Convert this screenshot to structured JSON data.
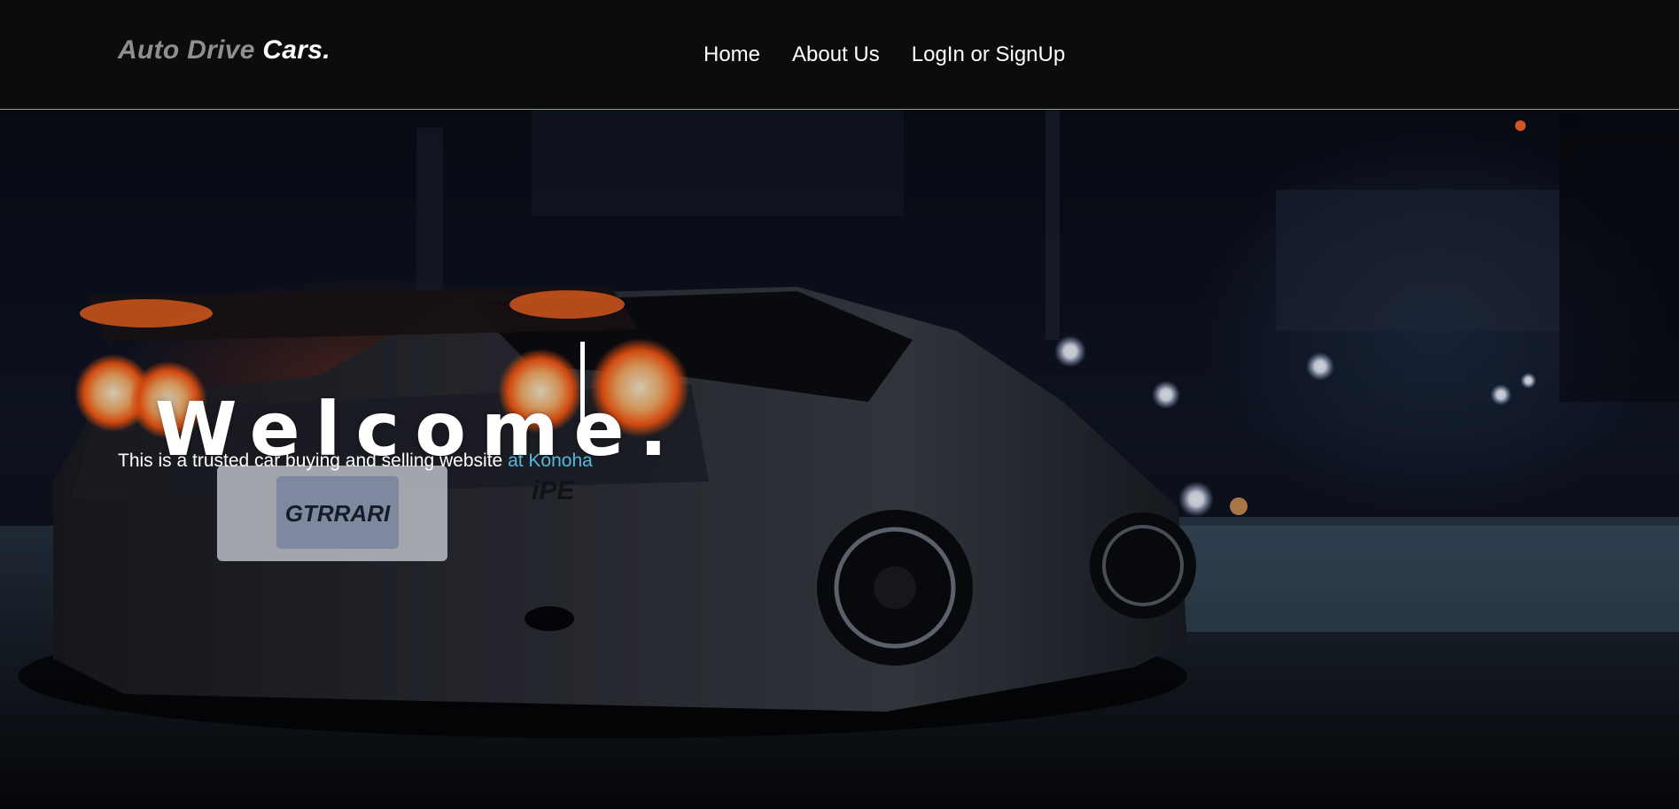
{
  "brand": {
    "part1": "Auto Drive",
    "part2": "Cars."
  },
  "nav": {
    "items": [
      "Home",
      "About Us",
      "LogIn or SignUp"
    ]
  },
  "hero": {
    "title": "Welcome.",
    "tagline": "This is a trusted car buying and selling website",
    "tagline_highlight": "at Konoha",
    "background_image": "night-sports-car-photo",
    "plate_text": "GTRRARI",
    "decal_text": "iPE"
  },
  "colors": {
    "header_bg": "#0c0c0c",
    "brand_muted": "#8f8f8f",
    "accent": "#56b8d8",
    "taillight": "#ff5a14"
  }
}
